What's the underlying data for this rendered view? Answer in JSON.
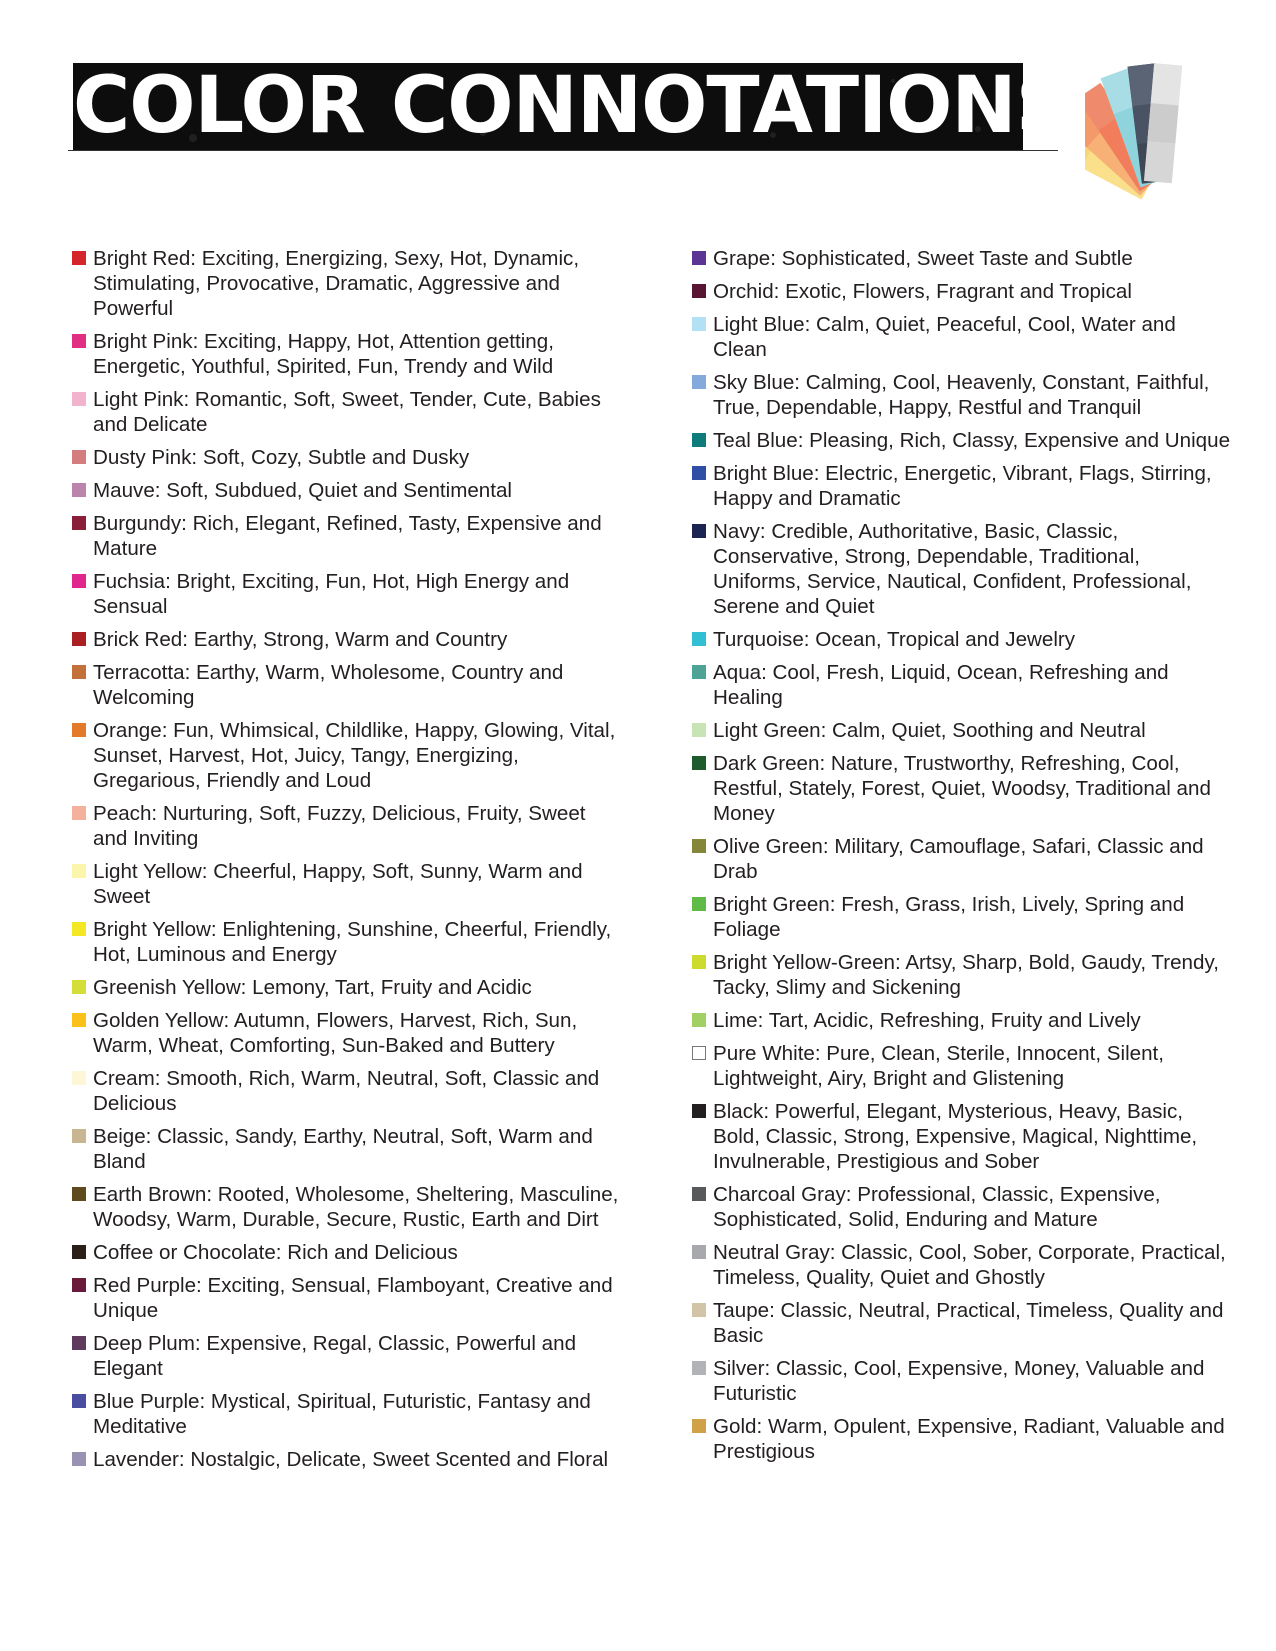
{
  "title": "COLOR CONNOTATIONS",
  "left_column": [
    {
      "color": "#d4252b",
      "text": "Bright Red:  Exciting, Energizing, Sexy, Hot, Dynamic, Stimulating, Provocative, Dramatic, Aggressive and Powerful"
    },
    {
      "color": "#e02e82",
      "text": "Bright Pink: Exciting, Happy, Hot, Attention getting, Energetic, Youthful, Spirited, Fun, Trendy and Wild"
    },
    {
      "color": "#f2b3cf",
      "text": "Light Pink: Romantic, Soft, Sweet, Tender, Cute, Babies and Delicate"
    },
    {
      "color": "#d47d7e",
      "text": "Dusty Pink: Soft, Cozy, Subtle and Dusky"
    },
    {
      "color": "#ba84ab",
      "text": "Mauve: Soft, Subdued, Quiet and Sentimental"
    },
    {
      "color": "#8a1f3a",
      "text": "Burgundy:  Rich, Elegant, Refined, Tasty, Expensive and Mature"
    },
    {
      "color": "#e0278d",
      "text": "Fuchsia: Bright, Exciting, Fun, Hot, High Energy and Sensual"
    },
    {
      "color": "#a91f22",
      "text": "Brick Red: Earthy, Strong, Warm and Country"
    },
    {
      "color": "#c4703a",
      "text": "Terracotta:  Earthy, Warm, Wholesome, Country and Welcoming"
    },
    {
      "color": "#e37a2a",
      "text": "Orange: Fun, Whimsical, Childlike, Happy, Glowing, Vital, Sunset, Harvest, Hot, Juicy, Tangy, Energizing, Gregarious, Friendly and Loud"
    },
    {
      "color": "#f4b19d",
      "text": "Peach: Nurturing, Soft, Fuzzy, Delicious, Fruity, Sweet and Inviting"
    },
    {
      "color": "#fcf6ac",
      "text": "Light Yellow: Cheerful, Happy, Soft, Sunny, Warm and Sweet"
    },
    {
      "color": "#f4e723",
      "text": "Bright Yellow: Enlightening, Sunshine, Cheerful, Friendly, Hot, Luminous and Energy"
    },
    {
      "color": "#d3df38",
      "text": "Greenish Yellow: Lemony, Tart, Fruity and Acidic"
    },
    {
      "color": "#f9c11a",
      "text": "Golden Yellow: Autumn, Flowers, Harvest, Rich, Sun, Warm, Wheat, Comforting, Sun-Baked and Buttery"
    },
    {
      "color": "#fdf6d7",
      "text": "Cream: Smooth, Rich, Warm, Neutral, Soft, Classic and Delicious"
    },
    {
      "color": "#c8b692",
      "text": "Beige: Classic, Sandy, Earthy, Neutral, Soft, Warm and Bland"
    },
    {
      "color": "#5f4a1e",
      "text": "Earth Brown: Rooted, Wholesome, Sheltering, Masculine, Woodsy, Warm, Durable, Secure, Rustic, Earth and Dirt"
    },
    {
      "color": "#2b1f17",
      "text": "Coffee or Chocolate: Rich and Delicious"
    },
    {
      "color": "#6a1a3b",
      "text": "Red Purple: Exciting, Sensual, Flamboyant, Creative and Unique"
    },
    {
      "color": "#5e3b5c",
      "text": "Deep Plum: Expensive, Regal, Classic, Powerful and Elegant"
    },
    {
      "color": "#4a4da0",
      "text": "Blue Purple: Mystical, Spiritual, Futuristic, Fantasy and Meditative"
    },
    {
      "color": "#9a92b3",
      "text": "Lavender: Nostalgic, Delicate, Sweet Scented and Floral"
    }
  ],
  "right_column": [
    {
      "color": "#5c3594",
      "text": "Grape: Sophisticated, Sweet Taste and Subtle"
    },
    {
      "color": "#5a1434",
      "text": "Orchid: Exotic, Flowers, Fragrant and Tropical"
    },
    {
      "color": "#b3e0f5",
      "text": "Light Blue: Calm, Quiet, Peaceful, Cool, Water and Clean"
    },
    {
      "color": "#83aadb",
      "text": "Sky Blue: Calming, Cool, Heavenly, Constant, Faithful, True, Dependable, Happy, Restful and Tranquil"
    },
    {
      "color": "#0e7c7b",
      "text": "Teal Blue: Pleasing, Rich, Classy, Expensive and Unique"
    },
    {
      "color": "#2e4fa3",
      "text": "Bright Blue: Electric, Energetic, Vibrant, Flags, Stirring, Happy and Dramatic"
    },
    {
      "color": "#1c2452",
      "text": "Navy: Credible, Authoritative, Basic, Classic, Conservative, Strong, Dependable, Traditional, Uniforms, Service, Nautical, Confident, Professional, Serene and Quiet"
    },
    {
      "color": "#33bfd3",
      "text": "Turquoise: Ocean, Tropical and Jewelry"
    },
    {
      "color": "#4ea396",
      "text": "Aqua: Cool, Fresh, Liquid, Ocean, Refreshing and Healing"
    },
    {
      "color": "#c8e4b5",
      "text": "Light Green: Calm, Quiet, Soothing and Neutral"
    },
    {
      "color": "#1d5a2c",
      "text": "Dark Green: Nature, Trustworthy, Refreshing, Cool, Restful, Stately, Forest, Quiet, Woodsy, Traditional and Money"
    },
    {
      "color": "#84863a",
      "text": "Olive Green: Military, Camouflage, Safari, Classic and Drab"
    },
    {
      "color": "#5fba47",
      "text": "Bright Green: Fresh, Grass, Irish, Lively, Spring and Foliage"
    },
    {
      "color": "#cddb2f",
      "text": "Bright Yellow-Green: Artsy, Sharp, Bold, Gaudy, Trendy, Tacky, Slimy and Sickening"
    },
    {
      "color": "#a3d064",
      "text": "Lime: Tart, Acidic, Refreshing, Fruity and Lively"
    },
    {
      "color": "#ffffff",
      "text": "Pure White: Pure, Clean, Sterile, Innocent, Silent, Lightweight, Airy, Bright and Glistening"
    },
    {
      "color": "#231f20",
      "text": "Black: Powerful, Elegant, Mysterious, Heavy, Basic, Bold, Classic, Strong, Expensive, Magical, Nighttime, Invulnerable, Prestigious and Sober"
    },
    {
      "color": "#58595b",
      "text": "Charcoal Gray:  Professional, Classic, Expensive, Sophisticated, Solid, Enduring and Mature"
    },
    {
      "color": "#a7a9ac",
      "text": "Neutral Gray: Classic, Cool, Sober, Corporate, Practical, Timeless, Quality, Quiet and Ghostly"
    },
    {
      "color": "#d2c4a6",
      "text": "Taupe: Classic, Neutral, Practical, Timeless, Quality and Basic"
    },
    {
      "color": "#b1b3b6",
      "text": "Silver: Classic, Cool, Expensive, Money, Valuable and Futuristic"
    },
    {
      "color": "#cfa24a",
      "text": "Gold: Warm, Opulent, Expensive, Radiant, Valuable and Prestigious"
    }
  ]
}
